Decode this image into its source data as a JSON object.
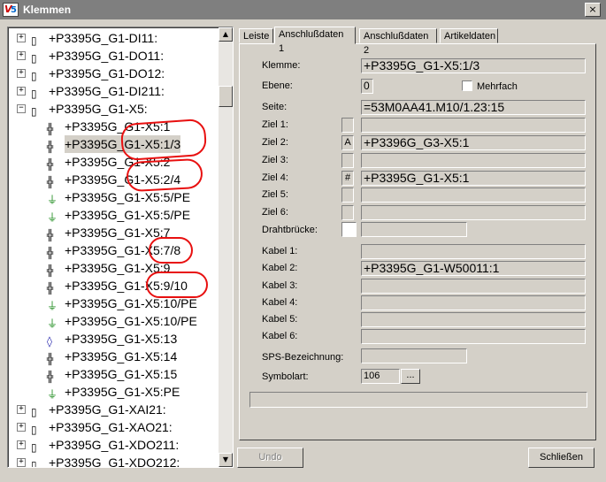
{
  "window": {
    "title": "Klemmen",
    "close_glyph": "×"
  },
  "tree": {
    "items": [
      {
        "label": "+P3395G_G1-DI11:",
        "expander": "+",
        "icon": "block"
      },
      {
        "label": "+P3395G_G1-DO11:",
        "expander": "+",
        "icon": "block"
      },
      {
        "label": "+P3395G_G1-DO12:",
        "expander": "+",
        "icon": "block"
      },
      {
        "label": "+P3395G_G1-DI211:",
        "expander": "+",
        "icon": "block"
      },
      {
        "label": "+P3395G_G1-X5:",
        "expander": "−",
        "icon": "block"
      },
      {
        "label": "+P3395G_G1-X5:1",
        "icon": "terminal"
      },
      {
        "label": "+P3395G_G1-X5:1/3",
        "icon": "terminal-bridge",
        "selected": true
      },
      {
        "label": "+P3395G_G1-X5:2",
        "icon": "terminal"
      },
      {
        "label": "+P3395G_G1-X5:2/4",
        "icon": "terminal-bridge"
      },
      {
        "label": "+P3395G_G1-X5:5/PE",
        "icon": "pe"
      },
      {
        "label": "+P3395G_G1-X5:5/PE",
        "icon": "pe"
      },
      {
        "label": "+P3395G_G1-X5:7",
        "icon": "terminal"
      },
      {
        "label": "+P3395G_G1-X5:7/8",
        "icon": "terminal-bridge"
      },
      {
        "label": "+P3395G_G1-X5:9",
        "icon": "terminal"
      },
      {
        "label": "+P3395G_G1-X5:9/10",
        "icon": "terminal-bridge"
      },
      {
        "label": "+P3395G_G1-X5:10/PE",
        "icon": "pe"
      },
      {
        "label": "+P3395G_G1-X5:10/PE",
        "icon": "pe"
      },
      {
        "label": "+P3395G_G1-X5:13",
        "icon": "terminal-plain"
      },
      {
        "label": "+P3395G_G1-X5:14",
        "icon": "terminal"
      },
      {
        "label": "+P3395G_G1-X5:15",
        "icon": "terminal-bridge"
      },
      {
        "label": "+P3395G_G1-X5:PE",
        "icon": "pe"
      },
      {
        "label": "+P3395G_G1-XAI21:",
        "expander": "+",
        "icon": "block"
      },
      {
        "label": "+P3395G_G1-XAO21:",
        "expander": "+",
        "icon": "block"
      },
      {
        "label": "+P3395G_G1-XDO211:",
        "expander": "+",
        "icon": "block"
      },
      {
        "label": "+P3395G_G1-XDO212:",
        "expander": "+",
        "icon": "block"
      }
    ],
    "scroll_up": "▲",
    "scroll_down": "▼"
  },
  "tabs": [
    {
      "label": "Leiste",
      "active": false
    },
    {
      "label": "Anschlußdaten 1",
      "active": true
    },
    {
      "label": "Anschlußdaten 2",
      "active": false
    },
    {
      "label": "Artikeldaten",
      "active": false
    }
  ],
  "form": {
    "klemme": {
      "label": "Klemme:",
      "value": "+P3395G_G1-X5:1/3"
    },
    "ebene": {
      "label": "Ebene:",
      "value": "0"
    },
    "mehrfach": {
      "label": "Mehrfach",
      "checked": false
    },
    "seite": {
      "label": "Seite:",
      "value": "=53M0AA41.M10/1.23:15"
    },
    "ziele": [
      {
        "label": "Ziel 1:",
        "flag": "",
        "value": ""
      },
      {
        "label": "Ziel 2:",
        "flag": "A",
        "value": "+P3396G_G3-X5:1"
      },
      {
        "label": "Ziel 3:",
        "flag": "",
        "value": ""
      },
      {
        "label": "Ziel 4:",
        "flag": "#",
        "value": "+P3395G_G1-X5:1"
      },
      {
        "label": "Ziel 5:",
        "flag": "",
        "value": ""
      },
      {
        "label": "Ziel 6:",
        "flag": "",
        "value": ""
      }
    ],
    "drahtbruecke": {
      "label": "Drahtbrücke:",
      "value": ""
    },
    "kabel": [
      {
        "label": "Kabel 1:",
        "value": ""
      },
      {
        "label": "Kabel 2:",
        "value": "+P3395G_G1-W50011:1"
      },
      {
        "label": "Kabel 3:",
        "value": ""
      },
      {
        "label": "Kabel 4:",
        "value": ""
      },
      {
        "label": "Kabel 5:",
        "value": ""
      },
      {
        "label": "Kabel 6:",
        "value": ""
      }
    ],
    "sps": {
      "label": "SPS-Bezeichnung:",
      "value": ""
    },
    "symbolart": {
      "label": "Symbolart:",
      "value": "106",
      "browse": "..."
    }
  },
  "buttons": {
    "undo": "Undo",
    "close": "Schließen"
  },
  "colors": {
    "annotation": "#e81010",
    "title_bar": "#7f7f7f",
    "face": "#d4d0c8"
  }
}
